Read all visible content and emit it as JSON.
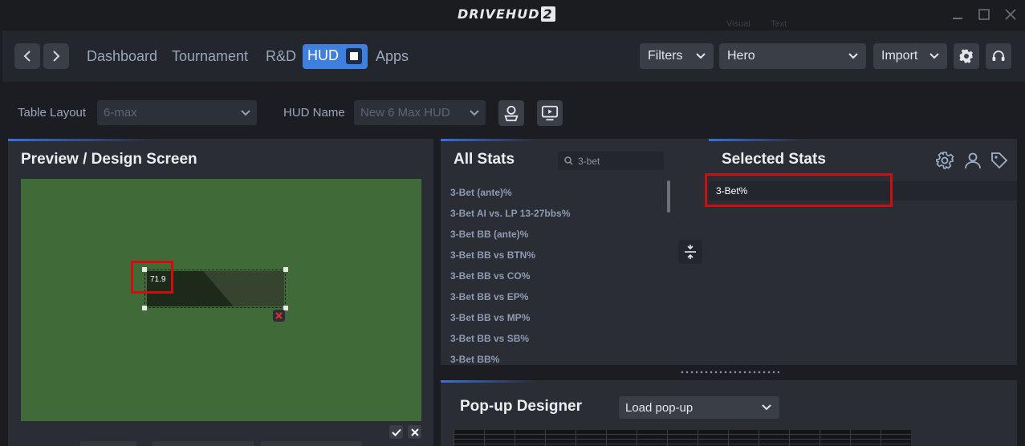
{
  "app": {
    "logo_text": "DRIVEHUD",
    "logo_suffix": "2"
  },
  "window_ghost": {
    "label1": "Visual",
    "label2": "Text"
  },
  "nav": {
    "back_icon": "chevron-left-icon",
    "forward_icon": "chevron-right-icon",
    "links": [
      "Dashboard",
      "Tournament",
      "R&D"
    ],
    "active_tab": "HUD",
    "last_link": "Apps",
    "filters_label": "Filters",
    "player_value": "Hero",
    "import_label": "Import"
  },
  "layout_row": {
    "table_layout_label": "Table Layout",
    "table_layout_value": "6-max",
    "hud_name_label": "HUD Name",
    "hud_name_value": "New 6 Max HUD"
  },
  "preview": {
    "title": "Preview / Design Screen",
    "stat_value": "71.9"
  },
  "all_stats": {
    "title": "All Stats",
    "search_value": "3-bet",
    "items": [
      "3-Bet (ante)%",
      "3-Bet AI vs. LP 13-27bbs%",
      "3-Bet BB (ante)%",
      "3-Bet BB vs BTN%",
      "3-Bet BB vs CO%",
      "3-Bet BB vs EP%",
      "3-Bet BB vs MP%",
      "3-Bet BB vs SB%",
      "3-Bet BB%"
    ]
  },
  "selected_stats": {
    "title": "Selected Stats",
    "items": [
      "3-Bet%"
    ]
  },
  "popup": {
    "title": "Pop-up Designer",
    "load_label": "Load pop-up"
  },
  "colors": {
    "accent": "#3f7fe0",
    "felt": "#416a39",
    "highlight": "#cc1010"
  }
}
